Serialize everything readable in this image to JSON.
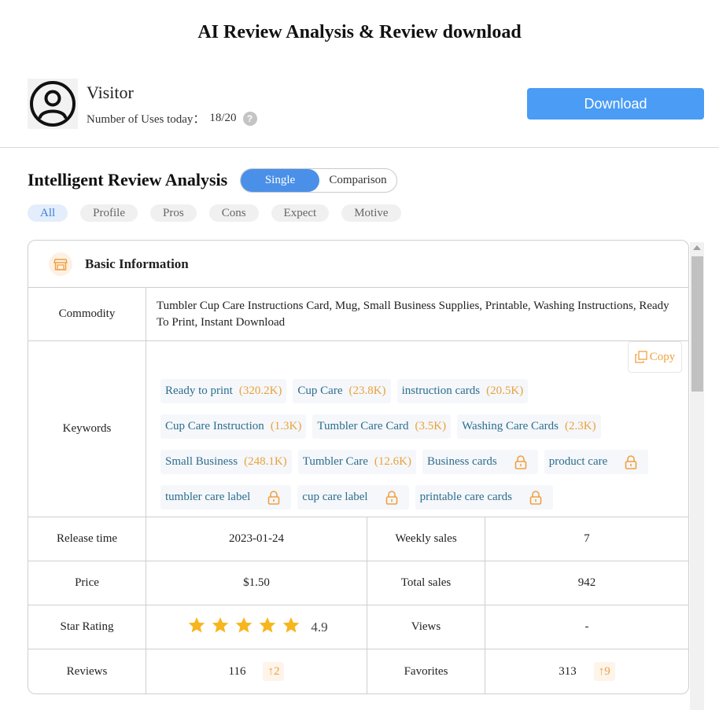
{
  "page": {
    "title": "AI Review Analysis & Review download"
  },
  "user": {
    "name": "Visitor",
    "uses_label": "Number of Uses today：",
    "uses_count": "18/20",
    "help_icon": "question-circle-icon"
  },
  "actions": {
    "download_label": "Download"
  },
  "analysis": {
    "title": "Intelligent Review Analysis",
    "modes": {
      "single": "Single",
      "comparison": "Comparison",
      "selected": "Single"
    },
    "filters": [
      "All",
      "Profile",
      "Pros",
      "Cons",
      "Expect",
      "Motive"
    ],
    "active_filter": "All"
  },
  "basic_info": {
    "title": "Basic Information",
    "icon": "store-icon",
    "commodity_label": "Commodity",
    "commodity": "Tumbler Cup Care Instructions Card, Mug, Small Business Supplies, Printable, Washing Instructions, Ready To Print, Instant Download",
    "keywords_label": "Keywords",
    "copy_label": "Copy",
    "keywords": [
      {
        "text": "Ready to print",
        "volume": "(320.2K)"
      },
      {
        "text": "Cup Care",
        "volume": "(23.8K)"
      },
      {
        "text": "instruction cards",
        "volume": "(20.5K)"
      },
      {
        "text": "Cup Care Instruction",
        "volume": "(1.3K)"
      },
      {
        "text": "Tumbler Care Card",
        "volume": "(3.5K)"
      },
      {
        "text": "Washing Care Cards",
        "volume": "(2.3K)"
      },
      {
        "text": "Small Business",
        "volume": "(248.1K)"
      },
      {
        "text": "Tumbler Care",
        "volume": "(12.6K)"
      },
      {
        "text": "Business cards",
        "locked": true
      },
      {
        "text": "product care",
        "locked": true
      },
      {
        "text": "tumbler care label",
        "locked": true
      },
      {
        "text": "cup care label",
        "locked": true
      },
      {
        "text": "printable care cards",
        "locked": true
      }
    ],
    "release_label": "Release time",
    "release_time": "2023-01-24",
    "weekly_sales_label": "Weekly sales",
    "weekly_sales": "7",
    "price_label": "Price",
    "price": "$1.50",
    "total_sales_label": "Total sales",
    "total_sales": "942",
    "rating_label": "Star Rating",
    "rating": "4.9",
    "rating_stars": 5,
    "views_label": "Views",
    "views": "-",
    "reviews_label": "Reviews",
    "reviews": "116",
    "reviews_delta": "↑2",
    "favorites_label": "Favorites",
    "favorites": "313",
    "favorites_delta": "↑9"
  },
  "colors": {
    "primary": "#4a9cf5",
    "toggle_active": "#4a90e8",
    "accent_orange": "#f0a040",
    "keyword_text": "#2c6e8e",
    "star": "#f7b51e"
  }
}
